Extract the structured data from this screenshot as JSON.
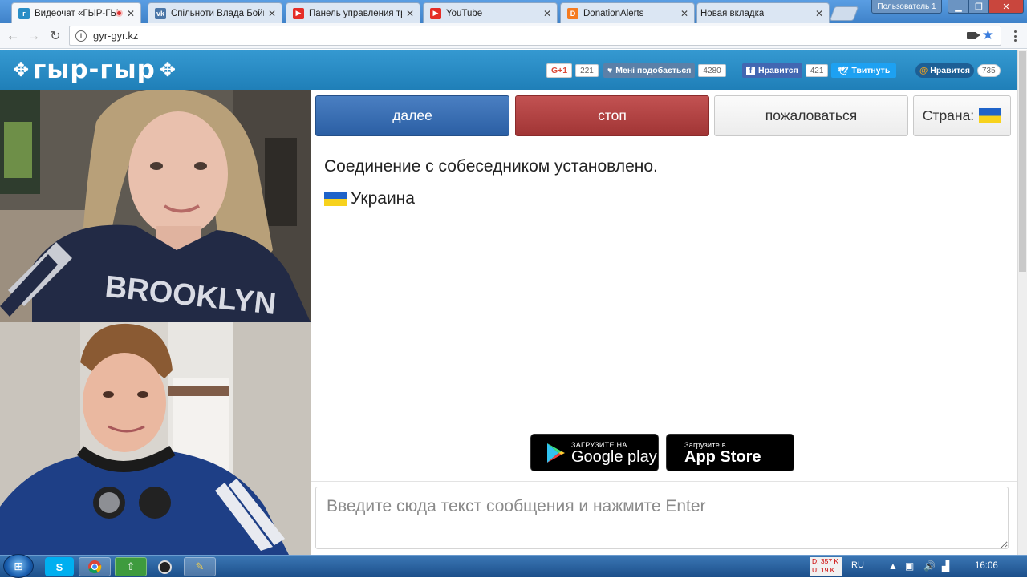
{
  "browser": {
    "tabs": [
      {
        "title": "Видеочат «ГЫР-ГЫ",
        "favicon": "gyr-icon",
        "active": true,
        "recording": true
      },
      {
        "title": "Спільноти Влада Бойк",
        "favicon": "vk-icon",
        "active": false
      },
      {
        "title": "Панель управления тр",
        "favicon": "youtube-icon",
        "active": false
      },
      {
        "title": "YouTube",
        "favicon": "youtube-icon",
        "active": false
      },
      {
        "title": "DonationAlerts",
        "favicon": "donationalerts-icon",
        "active": false
      },
      {
        "title": "Новая вкладка",
        "favicon": "",
        "active": false
      }
    ],
    "user_label": "Пользователь 1",
    "url": "gyr-gyr.kz"
  },
  "header": {
    "logo": "гыр-гыр",
    "social": {
      "gplus": {
        "label": "G+1",
        "count": "221"
      },
      "like": {
        "label": "Мені подобається",
        "count": "4280"
      },
      "facebook": {
        "label": "Нравится",
        "count": "421"
      },
      "twitter": {
        "label": "Твитнуть"
      },
      "mailru": {
        "label": "Нравится",
        "count": "735"
      }
    }
  },
  "controls": {
    "next": "далее",
    "stop": "стоп",
    "report": "пожаловаться",
    "country": "Страна:"
  },
  "chat": {
    "status": "Соединение с собеседником установлено.",
    "country": "Украина",
    "input_placeholder": "Введите сюда текст сообщения и нажмите Enter"
  },
  "stores": {
    "google": {
      "small": "ЗАГРУЗИТЕ НА",
      "big": "Google play"
    },
    "apple": {
      "small": "Загрузите в",
      "big": "App Store"
    }
  },
  "taskbar": {
    "net_down": "D: 357 K",
    "net_up": "U: 19 K",
    "lang": "RU",
    "time": "16:06"
  },
  "colors": {
    "header_bg": "#2a8ec6",
    "next_bg": "#2b5fa4",
    "stop_bg": "#a13535",
    "flag_blue": "#1f63c9",
    "flag_yellow": "#f7d21d"
  }
}
